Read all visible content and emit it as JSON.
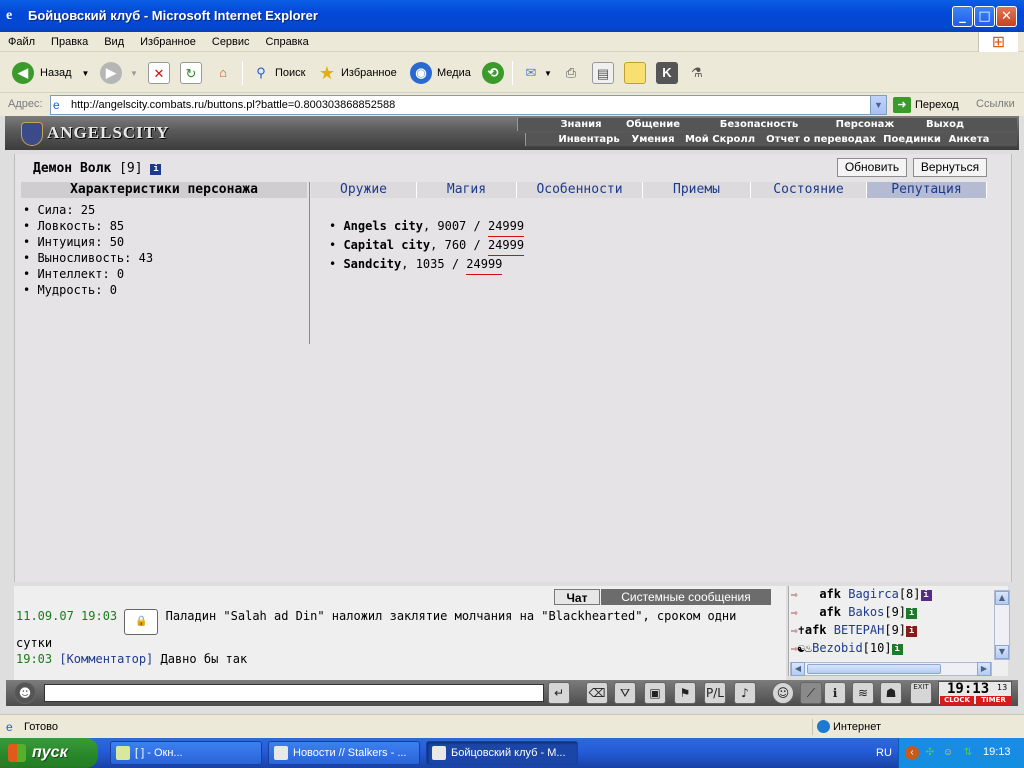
{
  "window": {
    "title": "Бойцовский клуб - Microsoft Internet Explorer",
    "minimize": "_",
    "maximize": "□",
    "close": "✕"
  },
  "menu": [
    "Файл",
    "Правка",
    "Вид",
    "Избранное",
    "Сервис",
    "Справка"
  ],
  "toolbar": {
    "back": "Назад",
    "search": "Поиск",
    "favorites": "Избранное",
    "media": "Медиа"
  },
  "address": {
    "label": "Адрес:",
    "url": "http://angelscity.combats.ru/buttons.pl?battle=0.800303868852588",
    "go": "Переход",
    "links": "Ссылки"
  },
  "game": {
    "logo": "ANGELSCITY",
    "nav_top": [
      "Знания",
      "Общение",
      "Безопасность",
      "Персонаж",
      "Выход"
    ],
    "nav_bottom": [
      "Инвентарь",
      "Умения",
      "Мой Скролл",
      "Отчет о переводах",
      "Поединки",
      "Анкета"
    ],
    "character": {
      "name": "Демон Волк",
      "level": "[9]",
      "info": "i"
    },
    "refresh_button": "Обновить",
    "back_button": "Вернуться",
    "stats_title": "Характеристики персонажа",
    "stats": [
      "Сила: 25",
      "Ловкость: 85",
      "Интуиция: 50",
      "Выносливость: 43",
      "Интеллект: 0",
      "Мудрость: 0"
    ],
    "tabs": [
      "Оружие",
      "Магия",
      "Особенности",
      "Приемы",
      "Состояние",
      "Репутация"
    ],
    "active_tab": "Репутация",
    "reputation": [
      {
        "city": "Angels city",
        "value": ", 9007 / ",
        "max": "24999"
      },
      {
        "city": "Capital city",
        "value": ", 760 / ",
        "max": "24999"
      },
      {
        "city": "Sandcity",
        "value": ", 1035 / ",
        "max": "24999"
      }
    ]
  },
  "chat": {
    "tab_chat": "Чат",
    "tab_system": "Системные сообщения",
    "line1": {
      "time": "11.09.07 19:03",
      "text": "Паладин \"Salah ad Din\" наложил заклятие молчания на \"Blackhearted\", сроком одни сутки"
    },
    "line2": {
      "time": "19:03",
      "who": "[Комментатор]",
      "text": " Давно бы так"
    }
  },
  "online": [
    {
      "afk": "afk",
      "name": "Bagirca",
      "level": "[8]"
    },
    {
      "afk": "afk",
      "name": "Bakos",
      "level": "[9]"
    },
    {
      "afk": "afk",
      "name": "ВЕТЕРАН",
      "level": "[9]"
    },
    {
      "afk": "",
      "name": "Bezobid",
      "level": "[10]"
    }
  ],
  "clock": {
    "time": "19:13",
    "seconds": "13",
    "clock_label": "CLOCK",
    "timer_label": "TIMER"
  },
  "status": {
    "text": "Готово",
    "zone": "Интернет"
  },
  "taskbar": {
    "start": "пуск",
    "tasks": [
      "[                  ] - Окн...",
      "Новости // Stalkers - ...",
      "Бойцовский клуб - М..."
    ],
    "lang": "RU",
    "time": "19:13"
  }
}
